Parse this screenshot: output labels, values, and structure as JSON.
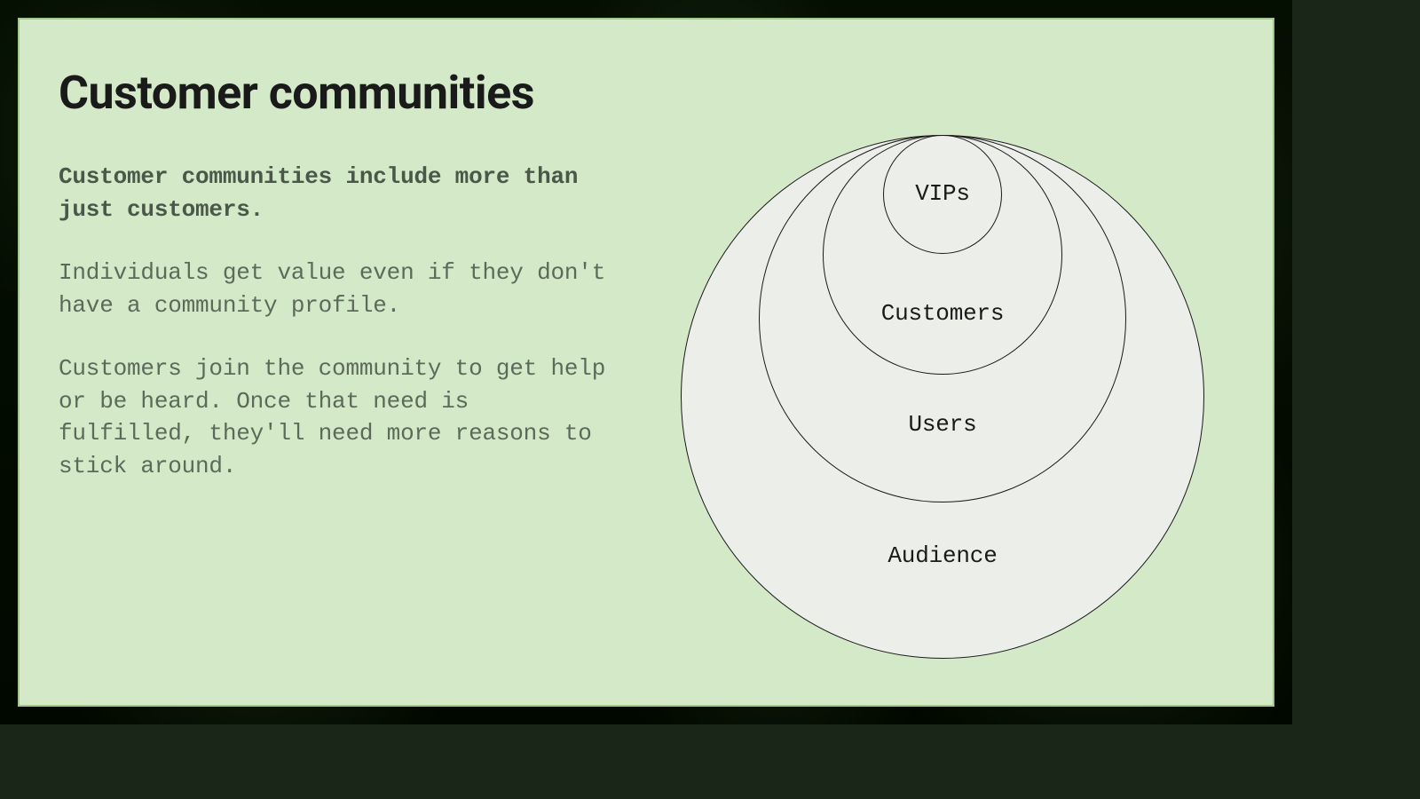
{
  "slide": {
    "title": "Customer communities",
    "lead": "Customer communities include more than just customers.",
    "para1": "Individuals get value even if they don't have a community profile.",
    "para2": "Customers join the community to get help or be heard. Once that need is fulfilled, they'll need more reasons to stick around."
  },
  "diagram": {
    "type": "nested-circles",
    "rings_outer_to_inner": [
      "Audience",
      "Users",
      "Customers",
      "VIPs"
    ],
    "r4": "Audience",
    "r3": "Users",
    "r2": "Customers",
    "r1": "VIPs"
  },
  "colors": {
    "slide_bg": "#d4e9c8",
    "slide_border": "#a4c888",
    "ring_fill": "#eceeea",
    "ring_stroke": "#1a1a1a",
    "title_color": "#1a1a1a",
    "body_color": "#5c6a5a"
  }
}
